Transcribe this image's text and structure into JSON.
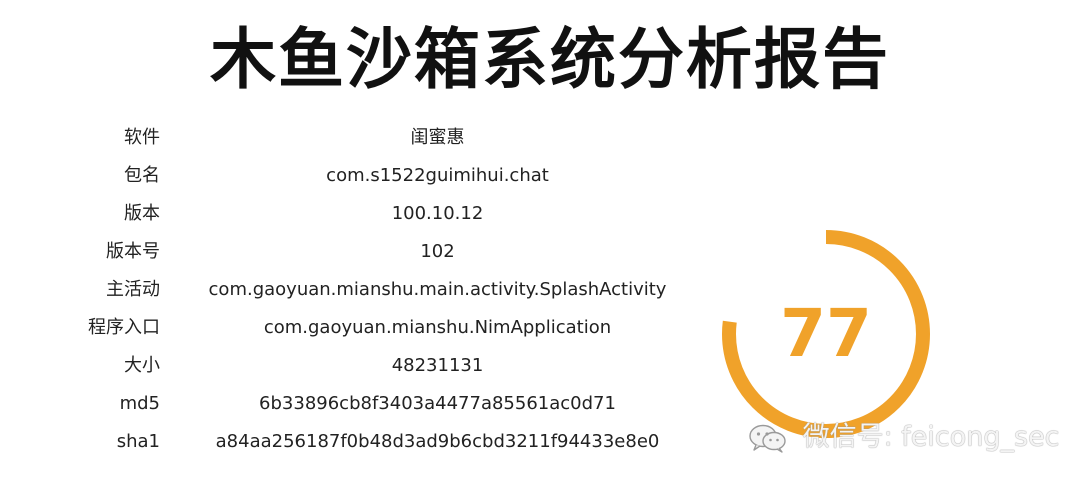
{
  "title": "木鱼沙箱系统分析报告",
  "info_rows": [
    {
      "label": "软件",
      "value": "闺蜜惠"
    },
    {
      "label": "包名",
      "value": "com.s1522guimihui.chat"
    },
    {
      "label": "版本",
      "value": "100.10.12"
    },
    {
      "label": "版本号",
      "value": "102"
    },
    {
      "label": "主活动",
      "value": "com.gaoyuan.mianshu.main.activity.SplashActivity"
    },
    {
      "label": "程序入口",
      "value": "com.gaoyuan.mianshu.NimApplication"
    },
    {
      "label": "大小",
      "value": "48231131"
    },
    {
      "label": "md5",
      "value": "6b33896cb8f3403a4477a85561ac0d71"
    },
    {
      "label": "sha1",
      "value": "a84aa256187f0b48d3ad9b6cbd3211f94433e8e0"
    }
  ],
  "score": {
    "value": "77",
    "max": 100,
    "color": "#f0a22a"
  },
  "watermark": {
    "icon": "wechat-icon",
    "text": "微信号: feicong_sec"
  }
}
